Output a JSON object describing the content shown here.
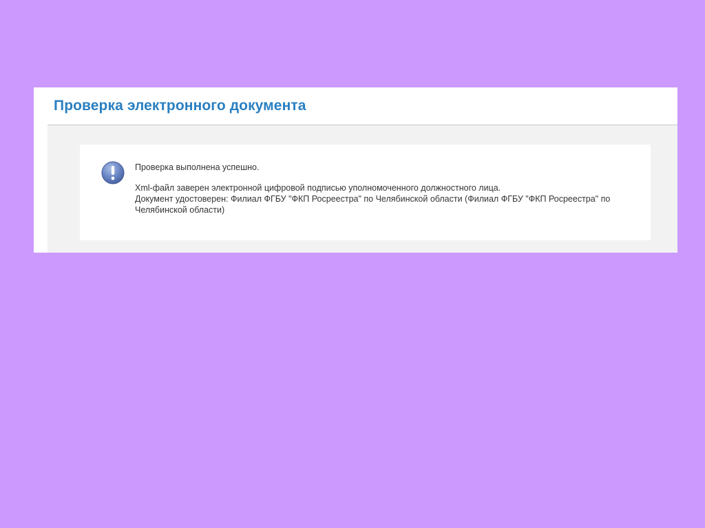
{
  "page": {
    "title": "Проверка электронного документа"
  },
  "message": {
    "icon": "info-exclamation-icon",
    "status": "Проверка выполнена успешно.",
    "detail_line_1": "Xml-файл заверен электронной цифровой подписью уполномоченного должностного лица.",
    "detail_line_2": "Документ удостоверен: Филиал ФГБУ \"ФКП Росреестра\" по Челябинской области (Филиал ФГБУ \"ФКП Росреестра\" по Челябинской области)"
  },
  "colors": {
    "background": "#cc99ff",
    "title": "#2a7fc1",
    "icon": "#6a86c4"
  }
}
